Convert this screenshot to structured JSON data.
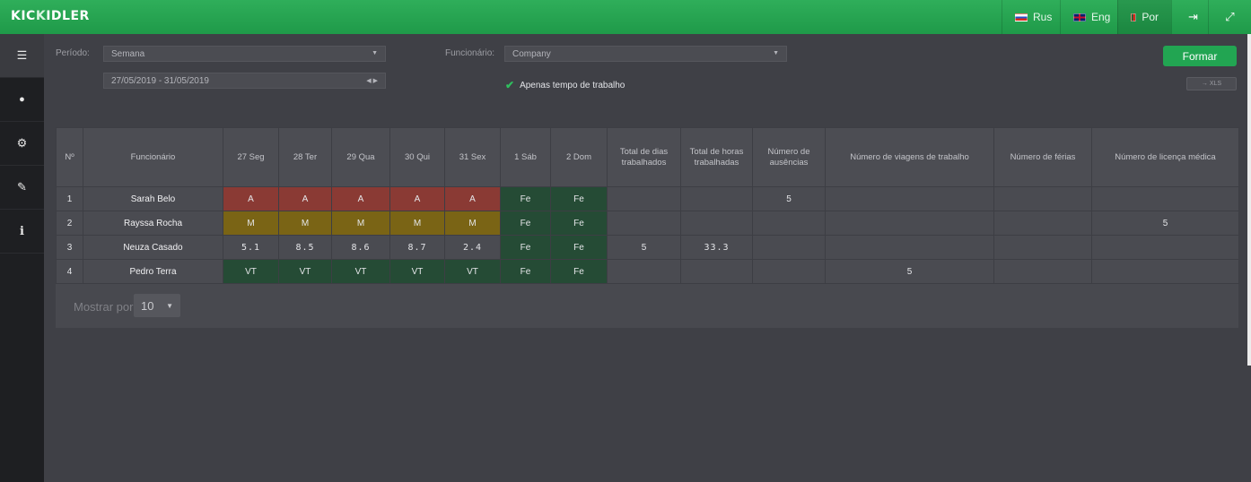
{
  "app": {
    "logo_prefix": "KIC",
    "logo_mark": "K",
    "logo_suffix": "IDLER"
  },
  "languages": [
    {
      "label": "Rus",
      "flag": "ru"
    },
    {
      "label": "Eng",
      "flag": "en"
    },
    {
      "label": "Por",
      "flag": "pt",
      "active": true
    }
  ],
  "topbar_icons": [
    "logout-icon",
    "fullscreen-icon"
  ],
  "sidebar": {
    "items": [
      {
        "icon": "list-icon",
        "glyph": "☰"
      },
      {
        "icon": "user-icon",
        "glyph": "👤"
      },
      {
        "icon": "gears-icon",
        "glyph": "⚙"
      },
      {
        "icon": "wrench-icon",
        "glyph": "🔧"
      },
      {
        "icon": "info-icon",
        "glyph": "i"
      }
    ]
  },
  "filters": {
    "period_label": "Período:",
    "period_value": "Semana",
    "date_range": "27/05/2019 - 31/05/2019",
    "employee_label": "Funcionário:",
    "employee_value": "Company",
    "work_time_only": "Apenas tempo de trabalho"
  },
  "buttons": {
    "formar": "Formar",
    "xls": "→ XLS"
  },
  "table": {
    "headers": [
      "Nº",
      "Funcionário",
      "27 Seg",
      "28 Ter",
      "29 Qua",
      "30 Qui",
      "31 Sex",
      "1 Sáb",
      "2 Dom",
      "Total de dias trabalhados",
      "Total de horas trabalhadas",
      "Número de ausências",
      "Número de viagens de trabalho",
      "Número de férias",
      "Número de licença médica"
    ],
    "rows": [
      {
        "n": "1",
        "name": "Sarah Belo",
        "days": [
          "A",
          "A",
          "A",
          "A",
          "A",
          "Fe",
          "Fe"
        ],
        "kind": "absent",
        "days_total": "",
        "hours_total": "",
        "absences": "5",
        "trips": "",
        "vacations": "",
        "sick": ""
      },
      {
        "n": "2",
        "name": "Rayssa Rocha",
        "days": [
          "M",
          "M",
          "M",
          "M",
          "M",
          "Fe",
          "Fe"
        ],
        "kind": "leave",
        "days_total": "",
        "hours_total": "",
        "absences": "",
        "trips": "",
        "vacations": "",
        "sick": "5"
      },
      {
        "n": "3",
        "name": "Neuza Casado",
        "days": [
          "5.1",
          "8.5",
          "8.6",
          "8.7",
          "2.4",
          "Fe",
          "Fe"
        ],
        "kind": "work",
        "days_total": "5",
        "hours_total": "33.3",
        "absences": "",
        "trips": "",
        "vacations": "",
        "sick": ""
      },
      {
        "n": "4",
        "name": "Pedro Terra",
        "days": [
          "VT",
          "VT",
          "VT",
          "VT",
          "VT",
          "Fe",
          "Fe"
        ],
        "kind": "trip",
        "days_total": "",
        "hours_total": "",
        "absences": "",
        "trips": "5",
        "vacations": "",
        "sick": ""
      }
    ]
  },
  "pager": {
    "label": "Mostrar por",
    "value": "10"
  },
  "colors": {
    "accent": "#22a552",
    "absent": "#8a3a34",
    "leave": "#7a6415",
    "weekend": "#254b35"
  }
}
